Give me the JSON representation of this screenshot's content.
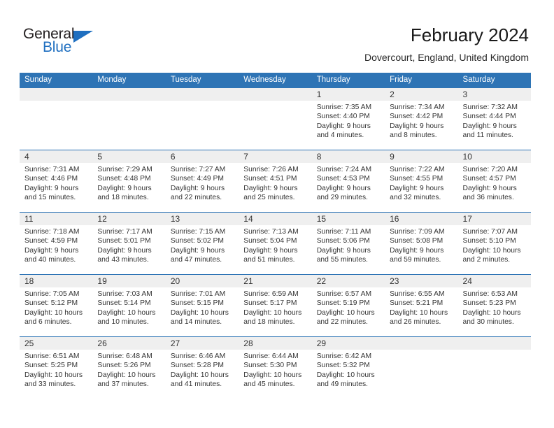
{
  "brand": {
    "name_top": "General",
    "name_bottom": "Blue",
    "color_dark": "#231f20",
    "color_blue": "#1f6fc0",
    "triangle_icon": "triangle-icon"
  },
  "header": {
    "title": "February 2024",
    "location": "Dovercourt, England, United Kingdom"
  },
  "theme": {
    "header_blue": "#2e74b5",
    "date_band_gray": "#efefef",
    "text_dark": "#343434"
  },
  "weekday_headers": [
    "Sunday",
    "Monday",
    "Tuesday",
    "Wednesday",
    "Thursday",
    "Friday",
    "Saturday"
  ],
  "weeks": [
    [
      {
        "day": "",
        "sunrise": "",
        "sunset": "",
        "daylight_l1": "",
        "daylight_l2": ""
      },
      {
        "day": "",
        "sunrise": "",
        "sunset": "",
        "daylight_l1": "",
        "daylight_l2": ""
      },
      {
        "day": "",
        "sunrise": "",
        "sunset": "",
        "daylight_l1": "",
        "daylight_l2": ""
      },
      {
        "day": "",
        "sunrise": "",
        "sunset": "",
        "daylight_l1": "",
        "daylight_l2": ""
      },
      {
        "day": "1",
        "sunrise": "Sunrise: 7:35 AM",
        "sunset": "Sunset: 4:40 PM",
        "daylight_l1": "Daylight: 9 hours",
        "daylight_l2": "and 4 minutes."
      },
      {
        "day": "2",
        "sunrise": "Sunrise: 7:34 AM",
        "sunset": "Sunset: 4:42 PM",
        "daylight_l1": "Daylight: 9 hours",
        "daylight_l2": "and 8 minutes."
      },
      {
        "day": "3",
        "sunrise": "Sunrise: 7:32 AM",
        "sunset": "Sunset: 4:44 PM",
        "daylight_l1": "Daylight: 9 hours",
        "daylight_l2": "and 11 minutes."
      }
    ],
    [
      {
        "day": "4",
        "sunrise": "Sunrise: 7:31 AM",
        "sunset": "Sunset: 4:46 PM",
        "daylight_l1": "Daylight: 9 hours",
        "daylight_l2": "and 15 minutes."
      },
      {
        "day": "5",
        "sunrise": "Sunrise: 7:29 AM",
        "sunset": "Sunset: 4:48 PM",
        "daylight_l1": "Daylight: 9 hours",
        "daylight_l2": "and 18 minutes."
      },
      {
        "day": "6",
        "sunrise": "Sunrise: 7:27 AM",
        "sunset": "Sunset: 4:49 PM",
        "daylight_l1": "Daylight: 9 hours",
        "daylight_l2": "and 22 minutes."
      },
      {
        "day": "7",
        "sunrise": "Sunrise: 7:26 AM",
        "sunset": "Sunset: 4:51 PM",
        "daylight_l1": "Daylight: 9 hours",
        "daylight_l2": "and 25 minutes."
      },
      {
        "day": "8",
        "sunrise": "Sunrise: 7:24 AM",
        "sunset": "Sunset: 4:53 PM",
        "daylight_l1": "Daylight: 9 hours",
        "daylight_l2": "and 29 minutes."
      },
      {
        "day": "9",
        "sunrise": "Sunrise: 7:22 AM",
        "sunset": "Sunset: 4:55 PM",
        "daylight_l1": "Daylight: 9 hours",
        "daylight_l2": "and 32 minutes."
      },
      {
        "day": "10",
        "sunrise": "Sunrise: 7:20 AM",
        "sunset": "Sunset: 4:57 PM",
        "daylight_l1": "Daylight: 9 hours",
        "daylight_l2": "and 36 minutes."
      }
    ],
    [
      {
        "day": "11",
        "sunrise": "Sunrise: 7:18 AM",
        "sunset": "Sunset: 4:59 PM",
        "daylight_l1": "Daylight: 9 hours",
        "daylight_l2": "and 40 minutes."
      },
      {
        "day": "12",
        "sunrise": "Sunrise: 7:17 AM",
        "sunset": "Sunset: 5:01 PM",
        "daylight_l1": "Daylight: 9 hours",
        "daylight_l2": "and 43 minutes."
      },
      {
        "day": "13",
        "sunrise": "Sunrise: 7:15 AM",
        "sunset": "Sunset: 5:02 PM",
        "daylight_l1": "Daylight: 9 hours",
        "daylight_l2": "and 47 minutes."
      },
      {
        "day": "14",
        "sunrise": "Sunrise: 7:13 AM",
        "sunset": "Sunset: 5:04 PM",
        "daylight_l1": "Daylight: 9 hours",
        "daylight_l2": "and 51 minutes."
      },
      {
        "day": "15",
        "sunrise": "Sunrise: 7:11 AM",
        "sunset": "Sunset: 5:06 PM",
        "daylight_l1": "Daylight: 9 hours",
        "daylight_l2": "and 55 minutes."
      },
      {
        "day": "16",
        "sunrise": "Sunrise: 7:09 AM",
        "sunset": "Sunset: 5:08 PM",
        "daylight_l1": "Daylight: 9 hours",
        "daylight_l2": "and 59 minutes."
      },
      {
        "day": "17",
        "sunrise": "Sunrise: 7:07 AM",
        "sunset": "Sunset: 5:10 PM",
        "daylight_l1": "Daylight: 10 hours",
        "daylight_l2": "and 2 minutes."
      }
    ],
    [
      {
        "day": "18",
        "sunrise": "Sunrise: 7:05 AM",
        "sunset": "Sunset: 5:12 PM",
        "daylight_l1": "Daylight: 10 hours",
        "daylight_l2": "and 6 minutes."
      },
      {
        "day": "19",
        "sunrise": "Sunrise: 7:03 AM",
        "sunset": "Sunset: 5:14 PM",
        "daylight_l1": "Daylight: 10 hours",
        "daylight_l2": "and 10 minutes."
      },
      {
        "day": "20",
        "sunrise": "Sunrise: 7:01 AM",
        "sunset": "Sunset: 5:15 PM",
        "daylight_l1": "Daylight: 10 hours",
        "daylight_l2": "and 14 minutes."
      },
      {
        "day": "21",
        "sunrise": "Sunrise: 6:59 AM",
        "sunset": "Sunset: 5:17 PM",
        "daylight_l1": "Daylight: 10 hours",
        "daylight_l2": "and 18 minutes."
      },
      {
        "day": "22",
        "sunrise": "Sunrise: 6:57 AM",
        "sunset": "Sunset: 5:19 PM",
        "daylight_l1": "Daylight: 10 hours",
        "daylight_l2": "and 22 minutes."
      },
      {
        "day": "23",
        "sunrise": "Sunrise: 6:55 AM",
        "sunset": "Sunset: 5:21 PM",
        "daylight_l1": "Daylight: 10 hours",
        "daylight_l2": "and 26 minutes."
      },
      {
        "day": "24",
        "sunrise": "Sunrise: 6:53 AM",
        "sunset": "Sunset: 5:23 PM",
        "daylight_l1": "Daylight: 10 hours",
        "daylight_l2": "and 30 minutes."
      }
    ],
    [
      {
        "day": "25",
        "sunrise": "Sunrise: 6:51 AM",
        "sunset": "Sunset: 5:25 PM",
        "daylight_l1": "Daylight: 10 hours",
        "daylight_l2": "and 33 minutes."
      },
      {
        "day": "26",
        "sunrise": "Sunrise: 6:48 AM",
        "sunset": "Sunset: 5:26 PM",
        "daylight_l1": "Daylight: 10 hours",
        "daylight_l2": "and 37 minutes."
      },
      {
        "day": "27",
        "sunrise": "Sunrise: 6:46 AM",
        "sunset": "Sunset: 5:28 PM",
        "daylight_l1": "Daylight: 10 hours",
        "daylight_l2": "and 41 minutes."
      },
      {
        "day": "28",
        "sunrise": "Sunrise: 6:44 AM",
        "sunset": "Sunset: 5:30 PM",
        "daylight_l1": "Daylight: 10 hours",
        "daylight_l2": "and 45 minutes."
      },
      {
        "day": "29",
        "sunrise": "Sunrise: 6:42 AM",
        "sunset": "Sunset: 5:32 PM",
        "daylight_l1": "Daylight: 10 hours",
        "daylight_l2": "and 49 minutes."
      },
      {
        "day": "",
        "sunrise": "",
        "sunset": "",
        "daylight_l1": "",
        "daylight_l2": ""
      },
      {
        "day": "",
        "sunrise": "",
        "sunset": "",
        "daylight_l1": "",
        "daylight_l2": ""
      }
    ]
  ]
}
